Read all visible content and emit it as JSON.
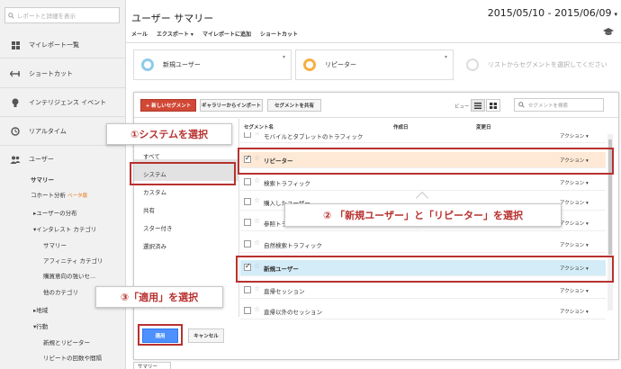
{
  "sidebar": {
    "search_placeholder": "レポートと詳細を表示",
    "nav": [
      {
        "label": "マイレポート一覧",
        "icon": "grid-icon"
      },
      {
        "label": "ショートカット",
        "icon": "arrows-icon"
      },
      {
        "label": "インテリジェンス イベント",
        "icon": "lightbulb-icon"
      },
      {
        "label": "リアルタイム",
        "icon": "clock-icon"
      },
      {
        "label": "ユーザー",
        "icon": "users-icon"
      }
    ],
    "sub_items": {
      "summary": "サマリー",
      "cohort": "コホート分析",
      "cohort_badge": "ベータ版",
      "users_flow": "▸ユーザーの分布",
      "in_market": "▾インタレスト カテゴリ",
      "overview": "サマリー",
      "affinity": "アフィニティ カテゴリ",
      "purchase": "購買意向の強いセ...",
      "other": "他のカテゴリ",
      "geo": "▸地域",
      "behavior": "▾行動",
      "new_returning": "新規とリピーター",
      "frequency": "リピートの回数や間隔"
    }
  },
  "header": {
    "title": "ユーザー サマリー",
    "date_range": "2015/05/10 - 2015/06/09",
    "toolbar": [
      "メール",
      "エクスポート ▾",
      "マイレポートに追加",
      "ショートカット"
    ]
  },
  "segments": {
    "chip1": "新規ユーザー",
    "chip2": "リピーター",
    "chip3": "リストからセグメントを選択してください"
  },
  "panel": {
    "new_segment": "+ 新しいセグメント",
    "import_gallery": "ギャラリーからインポート",
    "share_segment": "セグメントを共有",
    "view_label": "ビュー",
    "search_placeholder": "セグメントを検索",
    "categories": [
      "すべて",
      "システム",
      "カスタム",
      "共有",
      "スター付き",
      "選択済み"
    ],
    "columns": {
      "name": "セグメント名",
      "created": "作成日",
      "modified": "変更日"
    },
    "rows": [
      {
        "name": "モバイルとタブレットのトラフィック",
        "checked": false,
        "action": "アクション ▾"
      },
      {
        "name": "リピーター",
        "checked": true,
        "action": "アクション ▾"
      },
      {
        "name": "検索トラフィック",
        "checked": false,
        "action": "アクション ▾"
      },
      {
        "name": "購入したユーザー",
        "checked": false,
        "action": "アクション ▾"
      },
      {
        "name": "参照トラフィック",
        "checked": false,
        "action": "アクション ▾"
      },
      {
        "name": "自然検索トラフィック",
        "checked": false,
        "action": "アクション ▾"
      },
      {
        "name": "新規ユーザー",
        "checked": true,
        "action": "アクション ▾"
      },
      {
        "name": "直帰セッション",
        "checked": false,
        "action": "アクション ▾"
      },
      {
        "name": "直帰以外のセッション",
        "checked": false,
        "action": "アクション ▾"
      }
    ],
    "apply": "適用",
    "cancel": "キャンセル"
  },
  "bottom_tab": "サマリー",
  "annotations": {
    "step1": "①システムを選択",
    "step2": "② 「新規ユーザー」と「リピーター」を選択",
    "step3": "③「適用」を選択"
  },
  "colors": {
    "accent_red": "#b8312f",
    "apply_blue": "#4d90fe",
    "orange_highlight": "#fde9d5",
    "blue_highlight": "#d4ecf7"
  }
}
